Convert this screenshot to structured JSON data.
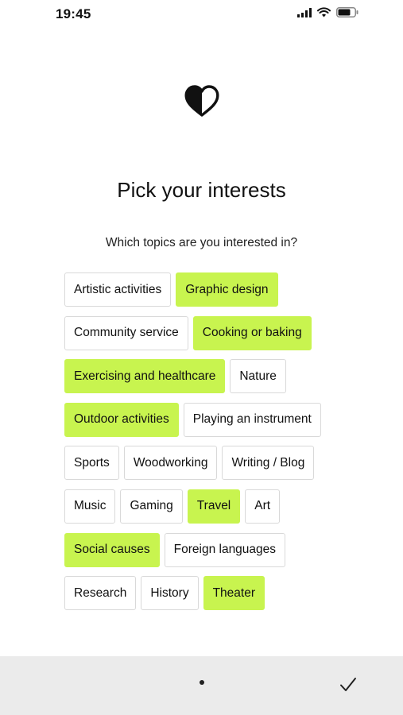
{
  "status_bar": {
    "time": "19:45",
    "icons": [
      "cellular-signal-icon",
      "wifi-icon",
      "battery-icon"
    ]
  },
  "logo": {
    "icon": "half-filled-heart-icon"
  },
  "title": "Pick your interests",
  "subtitle": "Which topics are you interested in?",
  "colors": {
    "selected_chip": "#c8f44f",
    "chip_border": "#d9d9d9",
    "bottom_bar": "#ebebeb"
  },
  "interests": [
    [
      {
        "label": "Artistic activities",
        "selected": false
      },
      {
        "label": "Graphic design",
        "selected": true
      }
    ],
    [
      {
        "label": "Community service",
        "selected": false
      },
      {
        "label": "Cooking or baking",
        "selected": true
      }
    ],
    [
      {
        "label": "Exercising and healthcare",
        "selected": true
      },
      {
        "label": "Nature",
        "selected": false
      }
    ],
    [
      {
        "label": "Outdoor activities",
        "selected": true
      },
      {
        "label": "Playing an instrument",
        "selected": false
      }
    ],
    [
      {
        "label": "Sports",
        "selected": false
      },
      {
        "label": "Woodworking",
        "selected": false
      },
      {
        "label": "Writing / Blog",
        "selected": false
      }
    ],
    [
      {
        "label": "Music",
        "selected": false
      },
      {
        "label": "Gaming",
        "selected": false
      },
      {
        "label": "Travel",
        "selected": true
      },
      {
        "label": "Art",
        "selected": false
      }
    ],
    [
      {
        "label": "Social causes",
        "selected": true
      },
      {
        "label": "Foreign languages",
        "selected": false
      }
    ],
    [
      {
        "label": "Research",
        "selected": false
      },
      {
        "label": "History",
        "selected": false
      },
      {
        "label": "Theater",
        "selected": true
      }
    ]
  ],
  "bottom_bar": {
    "page_indicator_count": 1,
    "done_icon": "checkmark-icon"
  }
}
